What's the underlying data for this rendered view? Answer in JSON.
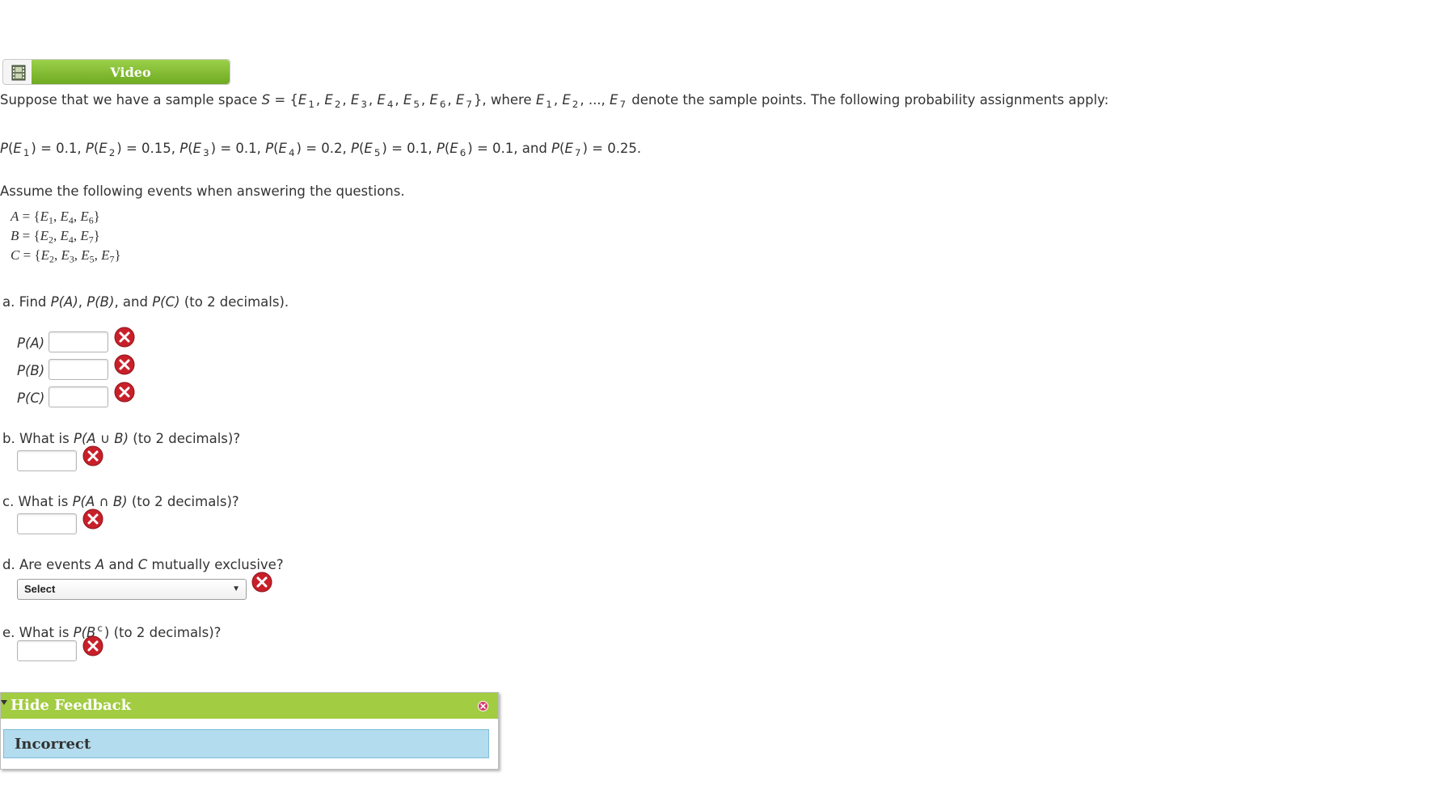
{
  "video": {
    "label": "Video",
    "icon": "film-icon"
  },
  "problem": {
    "intro": {
      "pre": "Suppose that we have a sample space ",
      "S": "S",
      "eq_open": " = {",
      "E": "E",
      "s1": "1",
      "s2": "2",
      "s3": "3",
      "s4": "4",
      "s5": "5",
      "s6": "6",
      "s7": "7",
      "comma": ", ",
      "close_where": "}, where ",
      "ellipsis": ", ..., ",
      "post": " denote the sample points. The following probability assignments apply:"
    },
    "assignments": {
      "P": "P",
      "E": "E",
      "p1": "1",
      "v1": ") = 0.1, ",
      "p2": "2",
      "v2": ") = 0.15, ",
      "p3": "3",
      "v3": ") = 0.1, ",
      "p4": "4",
      "v4": ") = 0.2, ",
      "p5": "5",
      "v5": ") = 0.1, ",
      "p6": "6",
      "v6": ") = 0.1, and ",
      "p7": "7",
      "v7": ") = 0.25.",
      "open": "("
    },
    "assume": "Assume the following events when answering the questions.",
    "events": [
      {
        "name": "A",
        "eq": " = {",
        "e": "E",
        "subs": [
          "1",
          "4",
          "6"
        ],
        "close": "}"
      },
      {
        "name": "B",
        "eq": " = {",
        "e": "E",
        "subs": [
          "2",
          "4",
          "7"
        ],
        "close": "}"
      },
      {
        "name": "C",
        "eq": " = {",
        "e": "E",
        "subs": [
          "2",
          "3",
          "5",
          "7"
        ],
        "close": "}"
      }
    ]
  },
  "questions": {
    "a": {
      "prefix": "a. Find ",
      "pa": "P(A)",
      "c1": ", ",
      "pb": "P(B)",
      "c2": ", and ",
      "pc": "P(C)",
      "suffix": " (to 2 decimals).",
      "labels": [
        "P(A)",
        "P(B)",
        "P(C)"
      ],
      "values": [
        "",
        "",
        ""
      ]
    },
    "b": {
      "prefix": "b. What is ",
      "expr_a": "P(A ",
      "op": "∪",
      "expr_b": " B)",
      "suffix": " (to 2 decimals)?",
      "value": ""
    },
    "c": {
      "prefix": "c. What is ",
      "expr_a": "P(A ",
      "op": "∩",
      "expr_b": " B)",
      "suffix": " (to 2 decimals)?",
      "value": ""
    },
    "d": {
      "prefix": "d. Are events ",
      "a": "A",
      "mid": " and ",
      "c": "C",
      "suffix": " mutually exclusive?",
      "select_value": "Select"
    },
    "e": {
      "prefix": "e. What is ",
      "expr": "P(B",
      "sup": "c",
      "close": ")",
      "suffix": " (to 2 decimals)?",
      "value": ""
    }
  },
  "feedback": {
    "header": "Hide Feedback",
    "result": "Incorrect"
  },
  "colors": {
    "video_green": "#7ab52e",
    "feedback_header": "#a2cc42",
    "feedback_result_bg": "#b3dcee",
    "error_red": "#c8202a"
  }
}
